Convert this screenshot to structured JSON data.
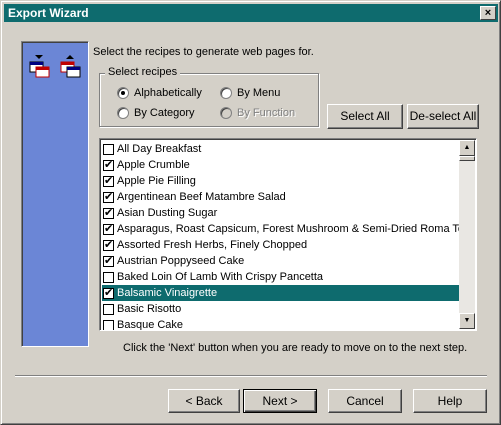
{
  "window": {
    "title": "Export Wizard",
    "close_label": "×"
  },
  "side_panel": {
    "icon": "sort-order-icon"
  },
  "instruction": "Select the recipes to generate web pages for.",
  "select_group": {
    "legend": "Select recipes",
    "options": [
      {
        "label": "Alphabetically",
        "selected": true,
        "enabled": true
      },
      {
        "label": "By Menu",
        "selected": false,
        "enabled": true
      },
      {
        "label": "By Category",
        "selected": false,
        "enabled": true
      },
      {
        "label": "By Function",
        "selected": false,
        "enabled": false
      }
    ]
  },
  "buttons": {
    "select_all": "Select All",
    "deselect_all": "De-select All",
    "back": "< Back",
    "next": "Next >",
    "cancel": "Cancel",
    "help": "Help"
  },
  "recipes": [
    {
      "name": "All Day Breakfast",
      "checked": false
    },
    {
      "name": "Apple Crumble",
      "checked": true
    },
    {
      "name": "Apple Pie Filling",
      "checked": true
    },
    {
      "name": "Argentinean Beef Matambre Salad",
      "checked": true
    },
    {
      "name": "Asian Dusting Sugar",
      "checked": true
    },
    {
      "name": "Asparagus, Roast Capsicum, Forest Mushroom & Semi-Dried Roma Tomat",
      "checked": true
    },
    {
      "name": "Assorted Fresh Herbs, Finely Chopped",
      "checked": true
    },
    {
      "name": "Austrian Poppyseed Cake",
      "checked": true
    },
    {
      "name": "Baked Loin Of Lamb With Crispy Pancetta",
      "checked": false
    },
    {
      "name": "Balsamic Vinaigrette",
      "checked": true,
      "selected": true
    },
    {
      "name": "Basic Risotto",
      "checked": false
    },
    {
      "name": "Basque Cake",
      "checked": false
    }
  ],
  "footer_note": "Click the 'Next' button when you are ready to move on to the next step.",
  "colors": {
    "titlebar": "#0e6b6e",
    "selection": "#0e6b6e",
    "side_panel": "#6b86d6"
  }
}
